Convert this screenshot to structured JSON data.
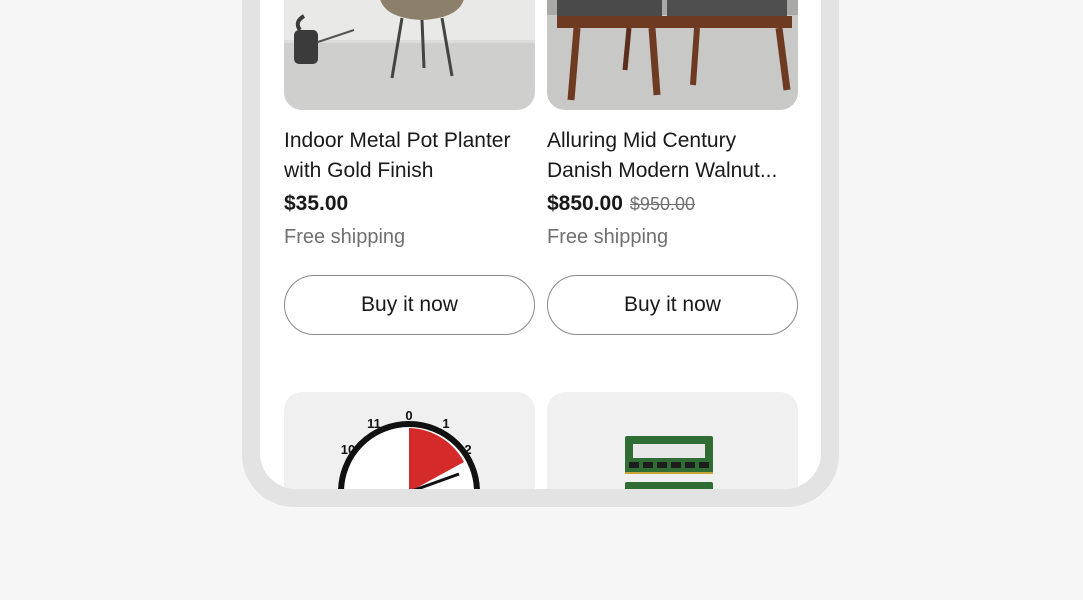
{
  "products": [
    {
      "title_lines": [
        "Indoor Metal Pot Planter",
        "with Gold Finish"
      ],
      "price": "$35.00",
      "original_price": "",
      "shipping": "Free shipping",
      "button_label": "Buy it now",
      "image": "planter-image"
    },
    {
      "title_lines": [
        "Alluring Mid Century",
        "Danish Modern Walnut..."
      ],
      "price": "$850.00",
      "original_price": "$950.00",
      "shipping": "Free shipping",
      "button_label": "Buy it now",
      "image": "chairs-image"
    }
  ],
  "partial_tiles": [
    {
      "image": "timer-clock-image",
      "clock_labels": [
        "0",
        "1",
        "2",
        "10",
        "11"
      ]
    },
    {
      "image": "ram-module-image"
    }
  ],
  "colors": {
    "background": "#f6f6f6",
    "frame": "#e3e3e3",
    "accent_red": "#d42a2a"
  }
}
